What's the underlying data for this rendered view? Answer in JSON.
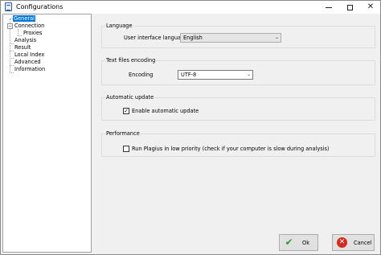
{
  "window": {
    "title": "Configurations"
  },
  "tree": {
    "items": [
      {
        "label": "General",
        "selected": true
      },
      {
        "label": "Connection",
        "expanded": true
      },
      {
        "label": "Proxies"
      },
      {
        "label": "Analysis"
      },
      {
        "label": "Result"
      },
      {
        "label": "Local Index"
      },
      {
        "label": "Advanced"
      },
      {
        "label": "Information"
      }
    ]
  },
  "language": {
    "group_title": "Language",
    "label": "User interface language",
    "value": "English"
  },
  "encoding": {
    "group_title": "Text files encoding",
    "label": "Encoding",
    "value": "UTF-8"
  },
  "update": {
    "group_title": "Automatic update",
    "checkbox_label": "Enable automatic update",
    "checked": true
  },
  "performance": {
    "group_title": "Performance",
    "checkbox_label": "Run Plagius in low priority (check if your computer is slow during analysis)",
    "checked": false
  },
  "buttons": {
    "ok": "Ok",
    "cancel": "Cancel"
  },
  "icons": {
    "app": "app-document-icon",
    "ok": "checkmark-icon",
    "cancel": "cancel-icon"
  },
  "colors": {
    "selection": "#0078d7",
    "cancel_icon": "#d42a1f",
    "ok_icon": "#2e9b2e"
  }
}
